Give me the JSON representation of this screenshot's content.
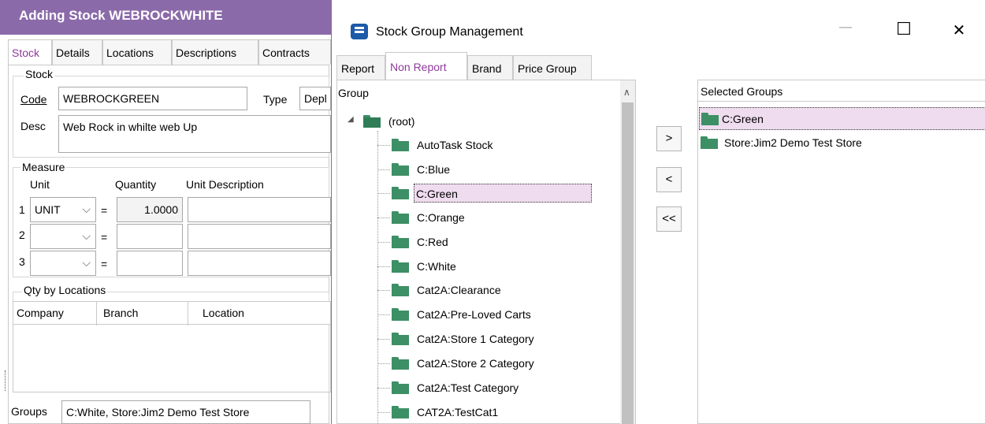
{
  "stock_window": {
    "title": "Adding Stock WEBROCKWHITE",
    "tabs": [
      "Stock",
      "Details",
      "Locations",
      "Descriptions",
      "Contracts"
    ],
    "stock_group": {
      "legend": "Stock",
      "code_label": "Code",
      "code_value": "WEBROCKGREEN",
      "type_label": "Type",
      "type_value": "Depl",
      "desc_label": "Desc",
      "desc_value": "Web Rock in whilte web Up"
    },
    "measure": {
      "legend": "Measure",
      "col_unit": "Unit",
      "col_quantity": "Quantity",
      "col_unit_description": "Unit Description",
      "rows": [
        {
          "num": "1",
          "unit": "UNIT",
          "eq": "=",
          "qty": "1.0000"
        },
        {
          "num": "2",
          "unit": "",
          "eq": "=",
          "qty": ""
        },
        {
          "num": "3",
          "unit": "",
          "eq": "=",
          "qty": ""
        }
      ]
    },
    "qty_by_locations": {
      "legend": "Qty by Locations",
      "columns": [
        "Company",
        "Branch",
        "Location"
      ]
    },
    "groups_label": "Groups",
    "groups_value": "C:White, Store:Jim2 Demo Test Store"
  },
  "dialog": {
    "title": "Stock Group Management",
    "controls": {
      "minimize": "—",
      "maximize": "☐",
      "close": "✕"
    },
    "tabs": [
      "Report",
      "Non Report",
      "Brand",
      "Price Group"
    ],
    "active_tab": "Non Report",
    "tree_header": "Group",
    "root_label": "(root)",
    "tree_items": [
      "AutoTask Stock",
      "C:Blue",
      "C:Green",
      "C:Orange",
      "C:Red",
      "C:White",
      "Cat2A:Clearance",
      "Cat2A:Pre-Loved Carts",
      "Cat2A:Store 1 Category",
      "Cat2A:Store 2 Category",
      "Cat2A:Test Category",
      "CAT2A:TestCat1"
    ],
    "selected_tree_item": "C:Green",
    "buttons": {
      "add": ">",
      "remove": "<",
      "remove_all": "<<"
    },
    "selected_header": "Selected Groups",
    "selected_groups": [
      "C:Green",
      "Store:Jim2 Demo Test Store"
    ]
  },
  "colors": {
    "title_bar": "#8b6aa9",
    "active_tab_text": "#8d3a9b",
    "folder": "#3d8f66",
    "selection": "#efdcef",
    "app_icon": "#1d5aa8"
  }
}
